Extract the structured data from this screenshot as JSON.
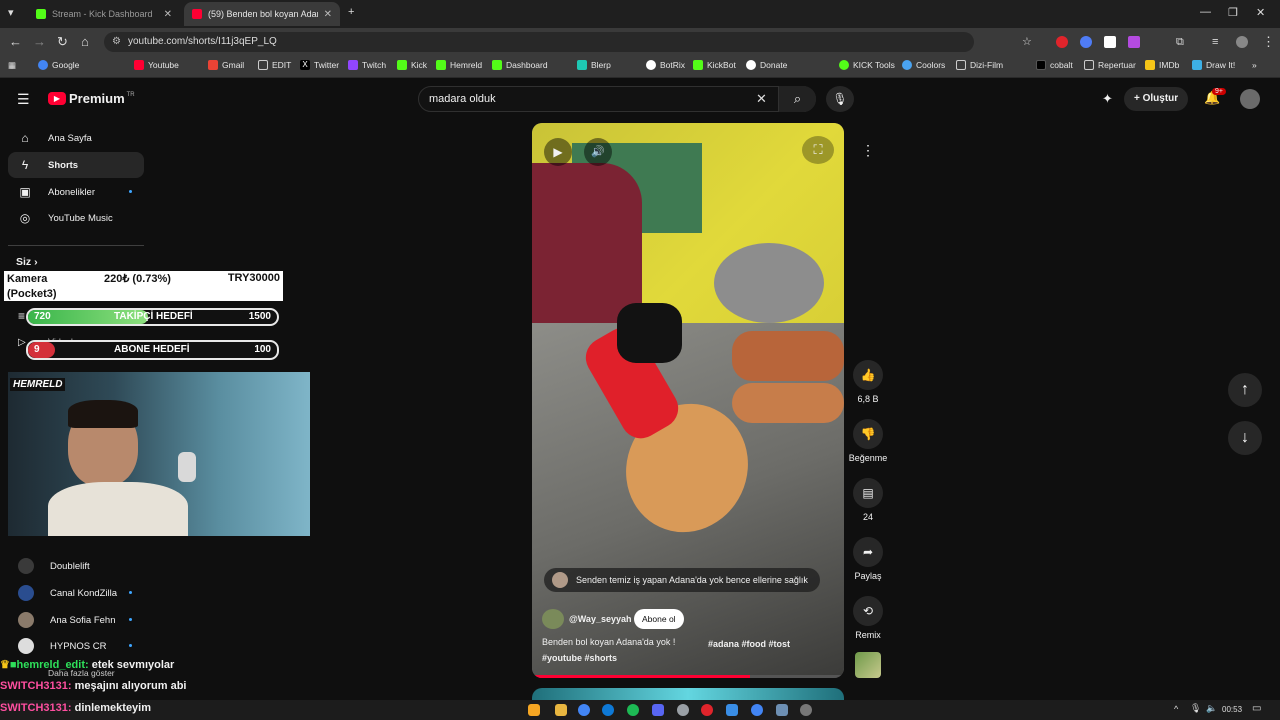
{
  "browser": {
    "tabs": [
      {
        "title": "Stream - Kick Dashboard",
        "active": false
      },
      {
        "title": "(59) Benden bol koyan Adana",
        "active": true
      }
    ],
    "url": "youtube.com/shorts/I11j3qEP_LQ",
    "bookmarks": [
      "Google",
      "Youtube",
      "Gmail",
      "EDIT",
      "Twitter",
      "Twitch",
      "Kick",
      "Hemreld",
      "Dashboard",
      "Blerp",
      "BotRix",
      "KickBot",
      "Donate",
      "KICK Tools",
      "Coolors",
      "Dizi-Film",
      "cobalt",
      "Repertuar",
      "IMDb",
      "Draw It!"
    ]
  },
  "youtube": {
    "logo_text": "Premium",
    "logo_badge": "TR",
    "search_value": "madara olduk",
    "create_label": "Oluştur",
    "notif_badge": "9+"
  },
  "sidebar": {
    "items": [
      {
        "label": "Ana Sayfa",
        "icon": "home-icon"
      },
      {
        "label": "Shorts",
        "icon": "shorts-icon"
      },
      {
        "label": "Abonelikler",
        "icon": "subscriptions-icon"
      },
      {
        "label": "YouTube Music",
        "icon": "music-icon"
      }
    ],
    "you_label": "Siz",
    "videos_label": "Videolarınız",
    "channels": [
      {
        "name": "Doublelift"
      },
      {
        "name": "Canal KondZilla"
      },
      {
        "name": "Ana Sofia Fehn"
      },
      {
        "name": "HYPNOS CR"
      }
    ],
    "show_more": "Daha fazla göster"
  },
  "overlay": {
    "kamera_name": "Kamera (Pocket3)",
    "kamera_price": "220₺ (0.73%)",
    "kamera_goal": "TRY30000",
    "follower_goal": {
      "current": "720",
      "label": "TAKİPÇİ HEDEFİ",
      "target": "1500",
      "fraction": 0.48
    },
    "sub_goal": {
      "current": "9",
      "label": "ABONE HEDEFİ",
      "target": "100",
      "fraction": 0.09
    },
    "webcam_brand": "HEMRELD"
  },
  "chat": [
    {
      "user": "hemreld_edit:",
      "message": "etek sevmıyolar",
      "color": "#2ee05a"
    },
    {
      "user": "SWITCH3131:",
      "message": "meşajını alıyorum abi",
      "color": "#ff4fa0"
    },
    {
      "user": "SWITCH3131:",
      "message": "dinlemekteyim",
      "color": "#ff4fa0"
    }
  ],
  "short": {
    "comment_preview": "Senden temiz iş yapan Adana'da yok bence ellerine sağlık",
    "channel": "@Way_seyyah",
    "subscribe_label": "Abone ol",
    "title": "Benden bol koyan Adana'da yok !",
    "hashtags": "#adana #food #tost #youtube #shorts",
    "likes": "6,8 B",
    "dislike_label": "Beğenme",
    "comments": "24",
    "share_label": "Paylaş",
    "remix_label": "Remix"
  },
  "taskbar": {
    "time": "00:53"
  }
}
